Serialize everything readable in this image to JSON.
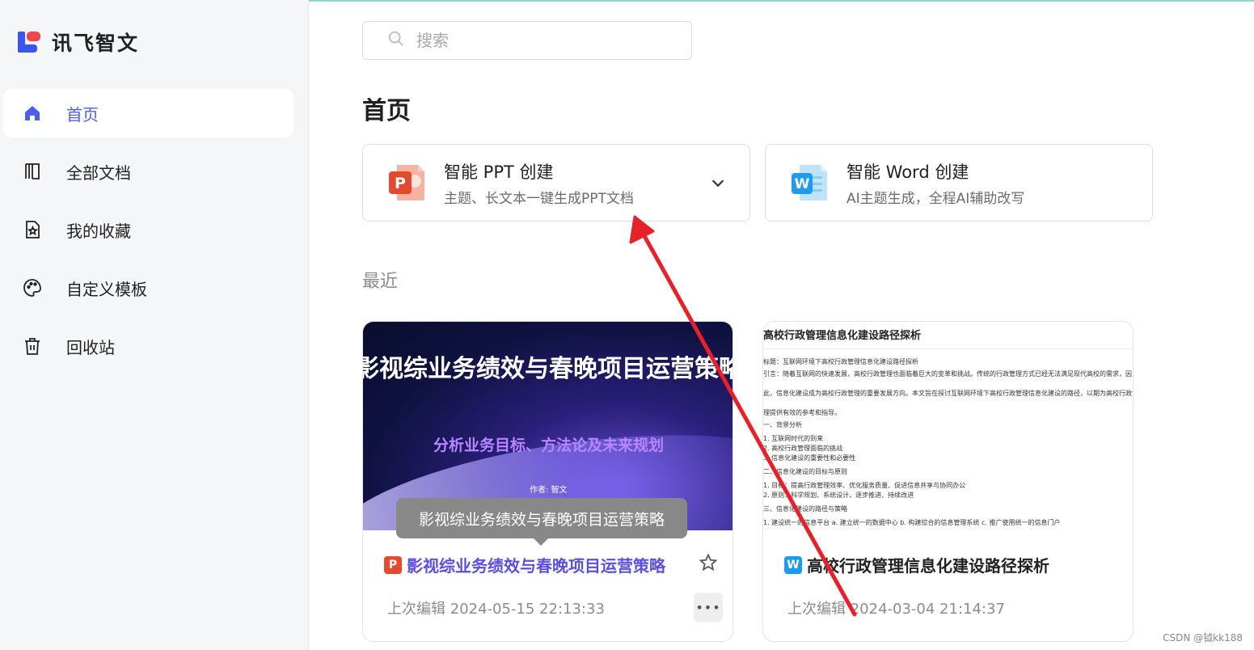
{
  "app": {
    "name": "讯飞智文"
  },
  "sidebar": {
    "items": [
      {
        "label": "首页",
        "icon": "home-icon",
        "active": true
      },
      {
        "label": "全部文档",
        "icon": "folder-icon",
        "active": false
      },
      {
        "label": "我的收藏",
        "icon": "star-doc-icon",
        "active": false
      },
      {
        "label": "自定义模板",
        "icon": "palette-icon",
        "active": false
      },
      {
        "label": "回收站",
        "icon": "trash-icon",
        "active": false
      }
    ]
  },
  "search": {
    "placeholder": "搜索",
    "value": ""
  },
  "main": {
    "title": "首页",
    "create_cards": [
      {
        "title": "智能 PPT 创建",
        "subtitle": "主题、长文本一键生成PPT文档",
        "icon": "ppt-icon"
      },
      {
        "title": "智能 Word 创建",
        "subtitle": "AI主题生成，全程AI辅助改写",
        "icon": "word-icon"
      }
    ],
    "recent_label": "最近",
    "docs": [
      {
        "type_badge": "P",
        "name": "影视综业务绩效与春晚项目运营策略",
        "edited": "上次编辑 2024-05-15 22:13:33",
        "thumb_title": "影视综业务绩效与春晚项目运营策略",
        "thumb_subtitle": "分析业务目标、方法论及未来规划",
        "thumb_author": "作者: 智文",
        "more_label": "•••"
      },
      {
        "type_badge": "W",
        "name": "高校行政管理信息化建设路径探析",
        "edited": "上次编辑 2024-03-04 21:14:37",
        "thumb_title": "高校行政管理信息化建设路径探析",
        "thumb_lines": [
          "标题：互联网环境下高校行政管理信息化建设路径探析",
          "引言：随着互联网的快速发展，高校行政管理也面临着巨大的变革和挑战。传统的行政管理方式已经无法满足现代高校的需求，因",
          "此，信息化建设成为高校行政管理的重要发展方向。本文旨在探讨互联网环境下高校行政管理信息化建设的路径，以期为高校行政管",
          "理提供有效的参考和指导。",
          "一、背景分析",
          "1. 互联网时代的到来",
          "2. 高校行政管理面临的挑战",
          "3. 信息化建设的重要性和必要性",
          "二、信息化建设的目标与原则",
          "1. 目标：提高行政管理效率、优化服务质量、促进信息共享与协同办公",
          "2. 原则：科学规划、系统设计、逐步推进、持续改进",
          "三、信息化建设的路径与策略",
          "1. 建设统一的信息平台 a. 建立统一的数据中心 b. 构建综合的信息管理系统 c. 推广使用统一的信息门户"
        ]
      }
    ]
  },
  "tooltip": {
    "text": "影视综业务绩效与春晚项目运营策略"
  },
  "watermark": "CSDN @钺kk188",
  "colors": {
    "accent": "#4c5ef0",
    "annotation_arrow": "#e8202a",
    "ppt_red": "#e54a2f",
    "word_blue": "#1e9bf0"
  }
}
